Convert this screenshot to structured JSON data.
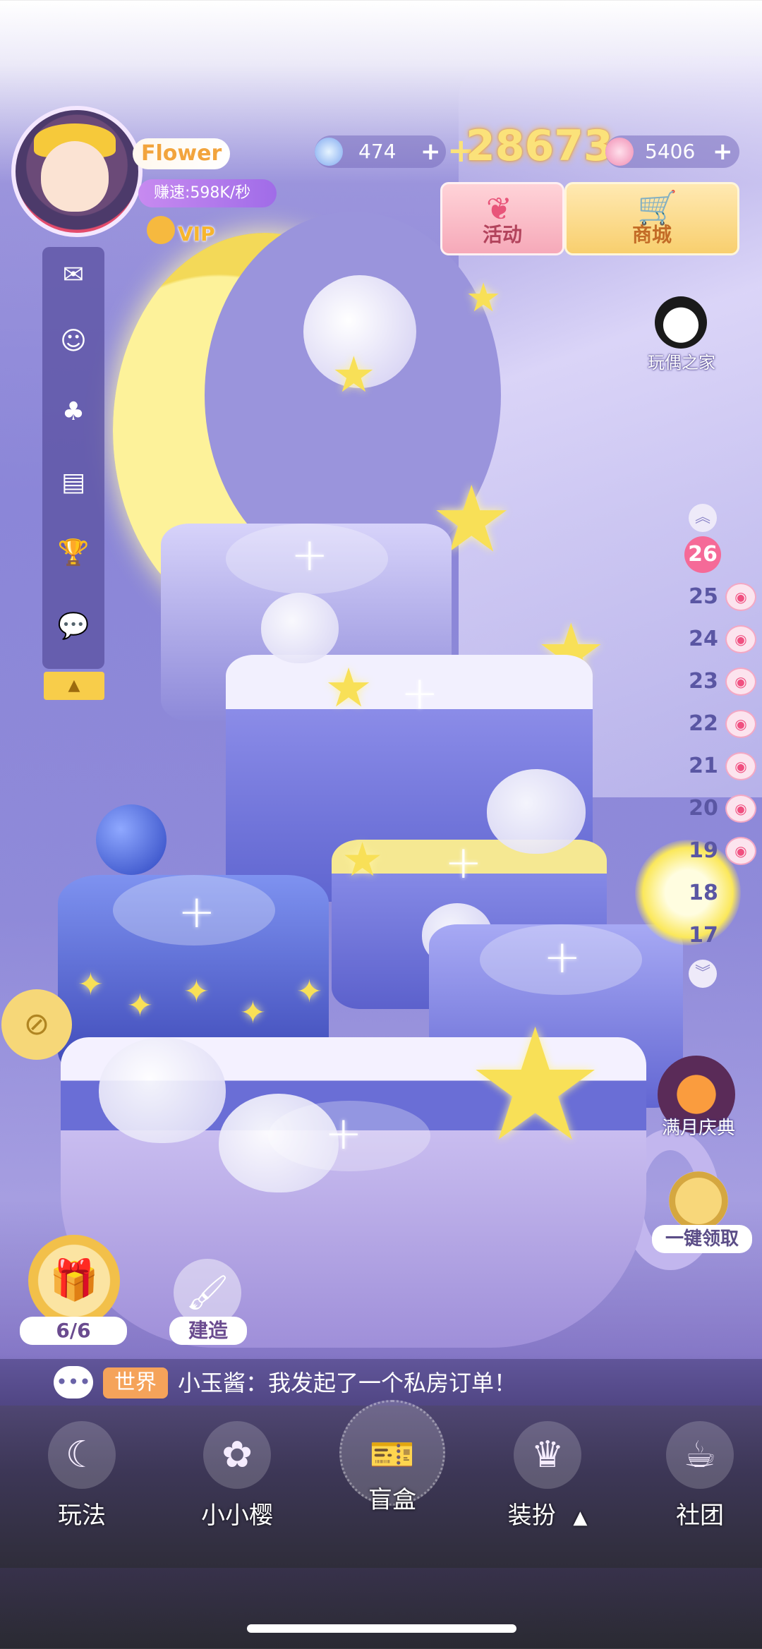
{
  "player": {
    "name": "Flower",
    "earn_rate": "赚速:598K/秒",
    "vip": "VIP"
  },
  "resources": {
    "gems": "474",
    "gold": "28673",
    "stars": "5406",
    "plus": "+"
  },
  "top_buttons": {
    "event": "活动",
    "shop": "商城"
  },
  "right_panel": {
    "doll_home": "玩偶之家",
    "current_floor": "26",
    "floors": [
      "25",
      "24",
      "23",
      "22",
      "21",
      "20",
      "19",
      "18",
      "17"
    ],
    "full_moon": "满月庆典",
    "collect_all": "一键领取"
  },
  "left_menu": {
    "arrow": "▲"
  },
  "bottom_controls": {
    "gift_count": "6/6",
    "build": "建造"
  },
  "chat": {
    "channel": "世界",
    "message": "小玉酱：我发起了一个私房订单！"
  },
  "nav": {
    "items": [
      {
        "label": "玩法"
      },
      {
        "label": "小小樱"
      },
      {
        "label": "盲盒"
      },
      {
        "label": "装扮"
      },
      {
        "label": "社团"
      }
    ],
    "expand_arrow": "▲"
  }
}
